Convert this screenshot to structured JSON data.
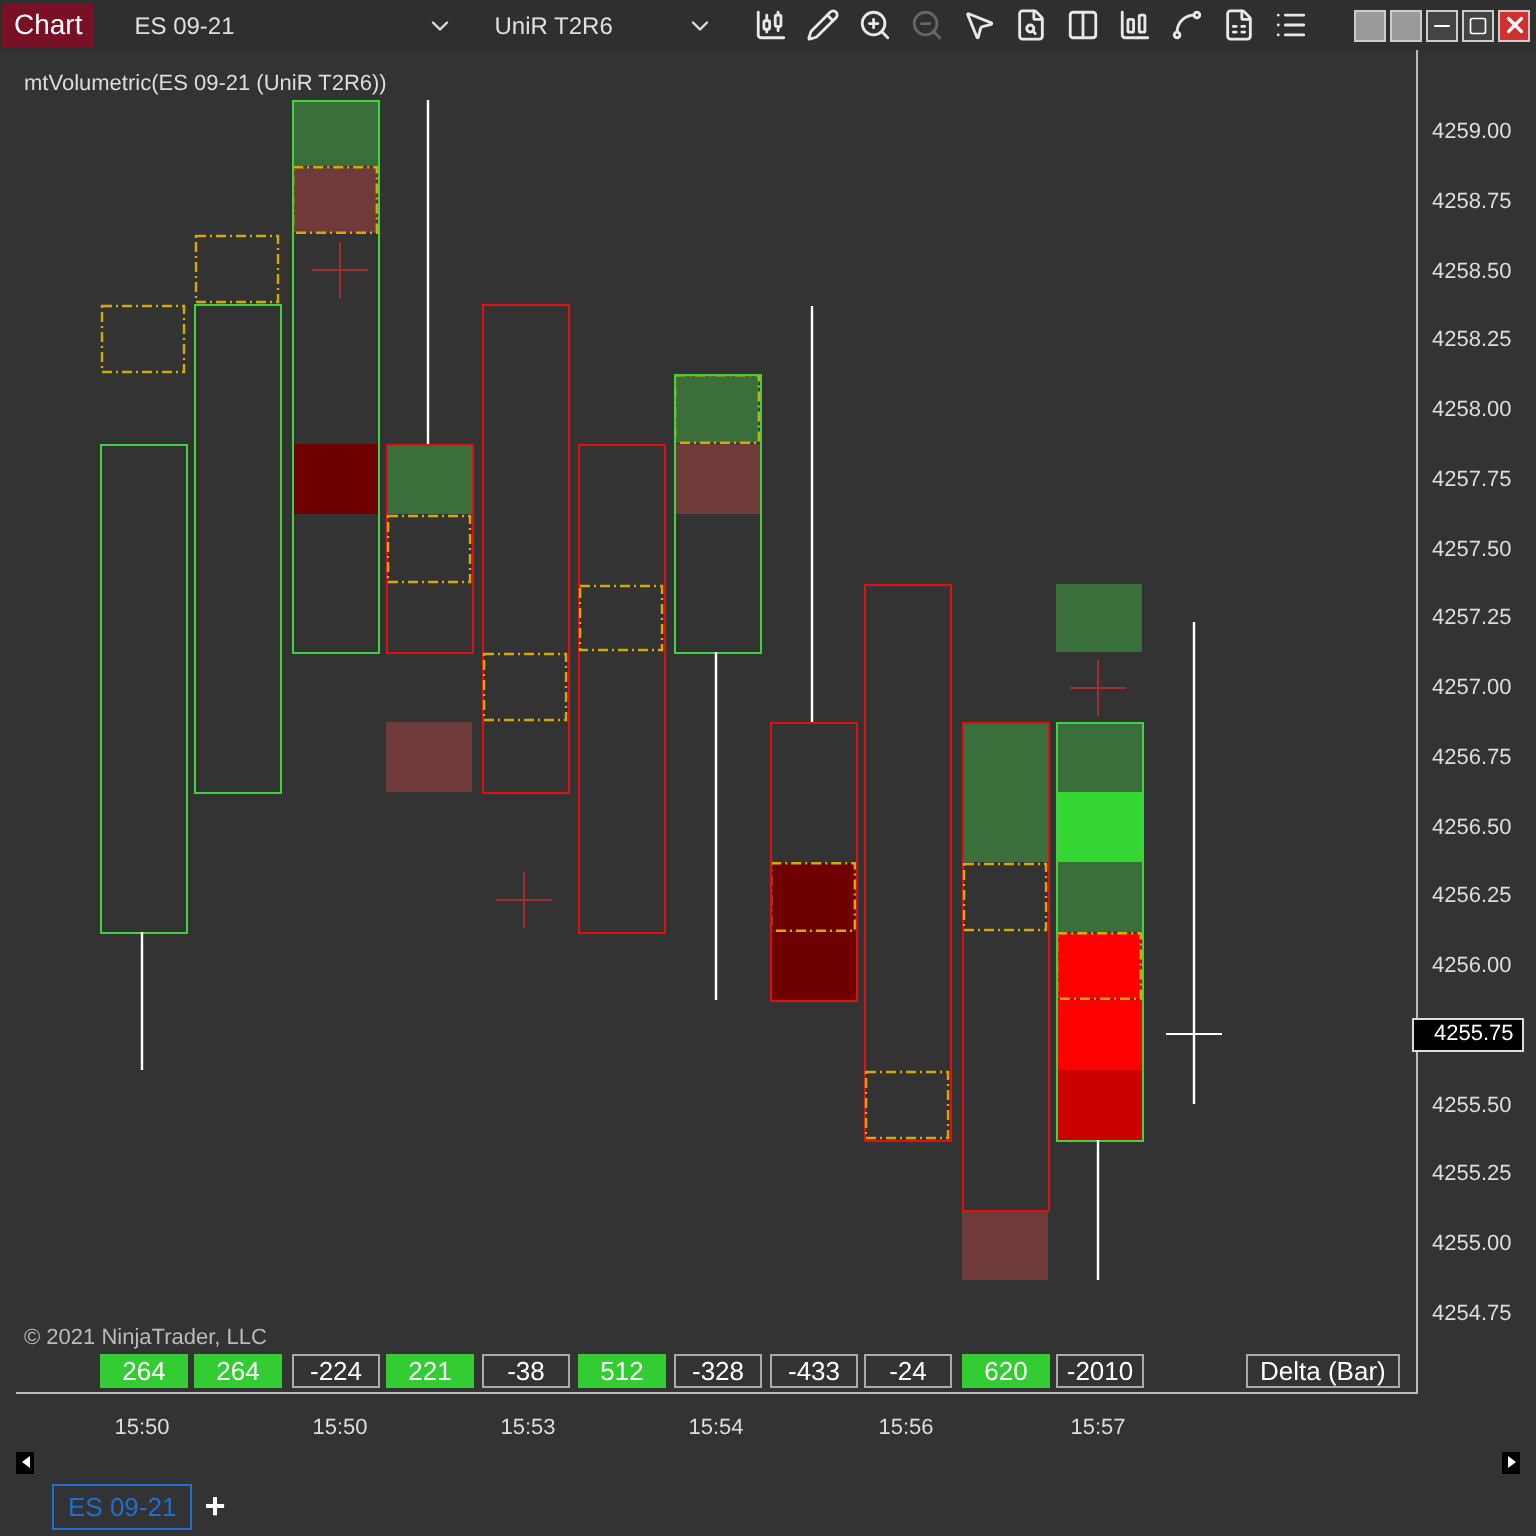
{
  "toolbar": {
    "title": "Chart",
    "instrument": "ES 09-21",
    "bars_type": "UniR T2R6"
  },
  "chart": {
    "indicator_label": "mtVolumetric(ES 09-21 (UniR T2R6))",
    "price_axis": [
      "4259.00",
      "4258.75",
      "4258.50",
      "4258.25",
      "4258.00",
      "4257.75",
      "4257.50",
      "4257.25",
      "4257.00",
      "4256.75",
      "4256.50",
      "4256.25",
      "4256.00",
      "4255.50",
      "4255.25",
      "4255.00",
      "4254.75"
    ],
    "current_price": "4255.75",
    "copyright": "© 2021 NinjaTrader, LLC",
    "delta_row": [
      {
        "value": "264",
        "positive": true
      },
      {
        "value": "264",
        "positive": true
      },
      {
        "value": "-224",
        "positive": false
      },
      {
        "value": "221",
        "positive": true
      },
      {
        "value": "-38",
        "positive": false
      },
      {
        "value": "512",
        "positive": true
      },
      {
        "value": "-328",
        "positive": false
      },
      {
        "value": "-433",
        "positive": false
      },
      {
        "value": "-24",
        "positive": false
      },
      {
        "value": "620",
        "positive": true
      },
      {
        "value": "-2010",
        "positive": false
      }
    ],
    "delta_label": "Delta (Bar)",
    "time_labels": [
      "15:50",
      "15:50",
      "15:53",
      "15:54",
      "15:56",
      "15:57"
    ]
  },
  "tabs": [
    {
      "label": "ES 09-21",
      "selected": true
    }
  ],
  "add_tab": "+"
}
